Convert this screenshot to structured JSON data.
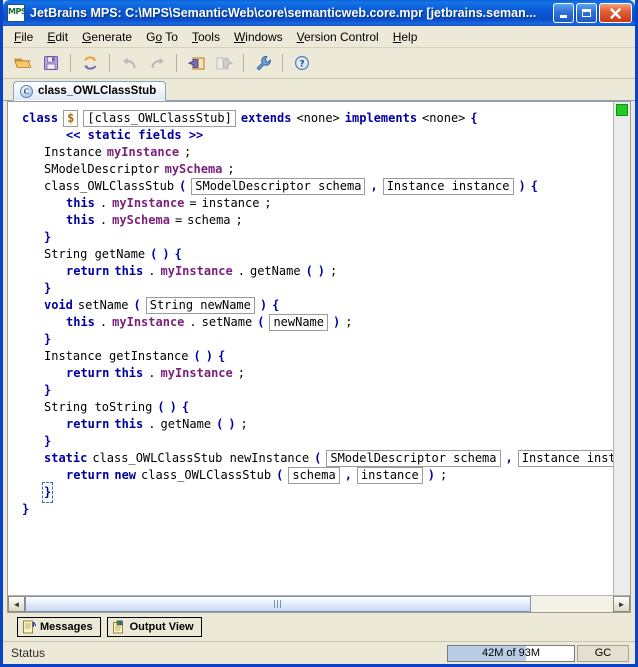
{
  "window": {
    "title": "JetBrains MPS: C:\\MPS\\SemanticWeb\\core\\semanticweb.core.mpr  [jetbrains.seman...",
    "app_icon_label": "MPS",
    "minimize_label": "Minimize",
    "maximize_label": "Maximize",
    "close_label": "Close"
  },
  "menubar": {
    "items": [
      {
        "label": "File",
        "pre": "",
        "mnemonic": "F",
        "post": "ile"
      },
      {
        "label": "Edit",
        "pre": "",
        "mnemonic": "E",
        "post": "dit"
      },
      {
        "label": "Generate",
        "pre": "",
        "mnemonic": "G",
        "post": "enerate"
      },
      {
        "label": "Go To",
        "pre": "G",
        "mnemonic": "o",
        "post": " To"
      },
      {
        "label": "Tools",
        "pre": "",
        "mnemonic": "T",
        "post": "ools"
      },
      {
        "label": "Windows",
        "pre": "",
        "mnemonic": "W",
        "post": "indows"
      },
      {
        "label": "Version Control",
        "pre": "",
        "mnemonic": "V",
        "post": "ersion Control"
      },
      {
        "label": "Help",
        "pre": "",
        "mnemonic": "H",
        "post": "elp"
      }
    ]
  },
  "toolbar": {
    "buttons": [
      {
        "name": "open-project-icon",
        "title": "Open Project",
        "enabled": true
      },
      {
        "name": "save-all-icon",
        "title": "Save All",
        "enabled": true
      },
      {
        "name": "refresh-icon",
        "title": "Refresh",
        "enabled": true
      },
      {
        "name": "undo-icon",
        "title": "Undo",
        "enabled": false
      },
      {
        "name": "redo-icon",
        "title": "Redo",
        "enabled": false
      },
      {
        "name": "back-icon",
        "title": "Back",
        "enabled": true
      },
      {
        "name": "forward-icon",
        "title": "Forward",
        "enabled": false
      },
      {
        "name": "settings-icon",
        "title": "Settings",
        "enabled": true
      },
      {
        "name": "help-icon",
        "title": "Help",
        "enabled": true
      }
    ]
  },
  "tabs": [
    {
      "label": "class_OWLClassStub",
      "icon": "C",
      "active": true
    }
  ],
  "editor": {
    "marker_color": "#22cc22",
    "lines": [
      {
        "id": "l1",
        "indent": 0,
        "tokens": [
          {
            "t": "class",
            "s": "kw",
            "cell": false
          },
          {
            "t": "$",
            "s": "dollar",
            "cell": true
          },
          {
            "t": "[class_OWLClassStub]",
            "s": "plain",
            "cell": true
          },
          {
            "t": "extends",
            "s": "kw",
            "cell": false
          },
          {
            "t": "<none>",
            "s": "plain",
            "cell": false
          },
          {
            "t": "implements",
            "s": "kw",
            "cell": false
          },
          {
            "t": "<none>",
            "s": "plain",
            "cell": false
          },
          {
            "t": "{",
            "s": "kw",
            "cell": false
          }
        ]
      },
      {
        "id": "l2",
        "indent": 2,
        "tokens": [
          {
            "t": "<< static fields >>",
            "s": "kw",
            "cell": false
          }
        ]
      },
      {
        "id": "l3",
        "indent": 1,
        "tokens": [
          {
            "t": "Instance",
            "s": "plain",
            "cell": false
          },
          {
            "t": "myInstance",
            "s": "fld",
            "cell": false
          },
          {
            "t": ";",
            "s": "plain",
            "cell": false
          }
        ]
      },
      {
        "id": "l4",
        "indent": 1,
        "tokens": [
          {
            "t": "SModelDescriptor",
            "s": "plain",
            "cell": false
          },
          {
            "t": "mySchema",
            "s": "fld",
            "cell": false
          },
          {
            "t": ";",
            "s": "plain",
            "cell": false
          }
        ]
      },
      {
        "id": "l5",
        "indent": 1,
        "tokens": [
          {
            "t": "class_OWLClassStub",
            "s": "plain",
            "cell": false
          },
          {
            "t": "(",
            "s": "kw",
            "cell": false
          },
          {
            "t": "SModelDescriptor schema",
            "s": "plain",
            "cell": true
          },
          {
            "t": ",",
            "s": "kw",
            "cell": false
          },
          {
            "t": "Instance instance",
            "s": "plain",
            "cell": true
          },
          {
            "t": ")",
            "s": "kw",
            "cell": false
          },
          {
            "t": "{",
            "s": "kw",
            "cell": false
          }
        ]
      },
      {
        "id": "l6",
        "indent": 2,
        "tokens": [
          {
            "t": "this",
            "s": "kw",
            "cell": false
          },
          {
            "t": ".",
            "s": "plain",
            "cell": false
          },
          {
            "t": "myInstance",
            "s": "fld",
            "cell": false
          },
          {
            "t": "=",
            "s": "plain",
            "cell": false
          },
          {
            "t": "instance",
            "s": "plain",
            "cell": false
          },
          {
            "t": ";",
            "s": "plain",
            "cell": false
          }
        ]
      },
      {
        "id": "l7",
        "indent": 2,
        "tokens": [
          {
            "t": "this",
            "s": "kw",
            "cell": false
          },
          {
            "t": ".",
            "s": "plain",
            "cell": false
          },
          {
            "t": "mySchema",
            "s": "fld",
            "cell": false
          },
          {
            "t": "=",
            "s": "plain",
            "cell": false
          },
          {
            "t": "schema",
            "s": "plain",
            "cell": false
          },
          {
            "t": ";",
            "s": "plain",
            "cell": false
          }
        ]
      },
      {
        "id": "l8",
        "indent": 1,
        "tokens": [
          {
            "t": "}",
            "s": "kw",
            "cell": false
          }
        ]
      },
      {
        "id": "l9",
        "indent": 1,
        "tokens": [
          {
            "t": "String getName",
            "s": "plain",
            "cell": false
          },
          {
            "t": "(",
            "s": "kw",
            "cell": false
          },
          {
            "t": ")",
            "s": "kw",
            "cell": false
          },
          {
            "t": "{",
            "s": "kw",
            "cell": false
          }
        ]
      },
      {
        "id": "l10",
        "indent": 2,
        "tokens": [
          {
            "t": "return",
            "s": "kw",
            "cell": false
          },
          {
            "t": "this",
            "s": "kw",
            "cell": false
          },
          {
            "t": ".",
            "s": "plain",
            "cell": false
          },
          {
            "t": "myInstance",
            "s": "fld",
            "cell": false
          },
          {
            "t": ".",
            "s": "plain",
            "cell": false
          },
          {
            "t": "getName",
            "s": "plain",
            "cell": false
          },
          {
            "t": "(",
            "s": "kw",
            "cell": false
          },
          {
            "t": ")",
            "s": "kw",
            "cell": false
          },
          {
            "t": ";",
            "s": "plain",
            "cell": false
          }
        ]
      },
      {
        "id": "l11",
        "indent": 1,
        "tokens": [
          {
            "t": "}",
            "s": "kw",
            "cell": false
          }
        ]
      },
      {
        "id": "l12",
        "indent": 1,
        "tokens": [
          {
            "t": "void",
            "s": "kw",
            "cell": false
          },
          {
            "t": "setName",
            "s": "plain",
            "cell": false
          },
          {
            "t": "(",
            "s": "kw",
            "cell": false
          },
          {
            "t": "String newName",
            "s": "plain",
            "cell": true
          },
          {
            "t": ")",
            "s": "kw",
            "cell": false
          },
          {
            "t": "{",
            "s": "kw",
            "cell": false
          }
        ]
      },
      {
        "id": "l13",
        "indent": 2,
        "tokens": [
          {
            "t": "this",
            "s": "kw",
            "cell": false
          },
          {
            "t": ".",
            "s": "plain",
            "cell": false
          },
          {
            "t": "myInstance",
            "s": "fld",
            "cell": false
          },
          {
            "t": ".",
            "s": "plain",
            "cell": false
          },
          {
            "t": "setName",
            "s": "plain",
            "cell": false
          },
          {
            "t": "(",
            "s": "kw",
            "cell": false
          },
          {
            "t": "newName",
            "s": "plain",
            "cell": true
          },
          {
            "t": ")",
            "s": "kw",
            "cell": false
          },
          {
            "t": ";",
            "s": "plain",
            "cell": false
          }
        ]
      },
      {
        "id": "l14",
        "indent": 1,
        "tokens": [
          {
            "t": "}",
            "s": "kw",
            "cell": false
          }
        ]
      },
      {
        "id": "l15",
        "indent": 1,
        "tokens": [
          {
            "t": "Instance getInstance",
            "s": "plain",
            "cell": false
          },
          {
            "t": "(",
            "s": "kw",
            "cell": false
          },
          {
            "t": ")",
            "s": "kw",
            "cell": false
          },
          {
            "t": "{",
            "s": "kw",
            "cell": false
          }
        ]
      },
      {
        "id": "l16",
        "indent": 2,
        "tokens": [
          {
            "t": "return",
            "s": "kw",
            "cell": false
          },
          {
            "t": "this",
            "s": "kw",
            "cell": false
          },
          {
            "t": ".",
            "s": "plain",
            "cell": false
          },
          {
            "t": "myInstance",
            "s": "fld",
            "cell": false
          },
          {
            "t": ";",
            "s": "plain",
            "cell": false
          }
        ]
      },
      {
        "id": "l17",
        "indent": 1,
        "tokens": [
          {
            "t": "}",
            "s": "kw",
            "cell": false
          }
        ]
      },
      {
        "id": "l18",
        "indent": 1,
        "tokens": [
          {
            "t": "String toString",
            "s": "plain",
            "cell": false
          },
          {
            "t": "(",
            "s": "kw",
            "cell": false
          },
          {
            "t": ")",
            "s": "kw",
            "cell": false
          },
          {
            "t": "{",
            "s": "kw",
            "cell": false
          }
        ]
      },
      {
        "id": "l19",
        "indent": 2,
        "tokens": [
          {
            "t": "return",
            "s": "kw",
            "cell": false
          },
          {
            "t": "this",
            "s": "kw",
            "cell": false
          },
          {
            "t": ".",
            "s": "plain",
            "cell": false
          },
          {
            "t": "getName",
            "s": "plain",
            "cell": false
          },
          {
            "t": "(",
            "s": "kw",
            "cell": false
          },
          {
            "t": ")",
            "s": "kw",
            "cell": false
          },
          {
            "t": ";",
            "s": "plain",
            "cell": false
          }
        ]
      },
      {
        "id": "l20",
        "indent": 1,
        "tokens": [
          {
            "t": "}",
            "s": "kw",
            "cell": false
          }
        ]
      },
      {
        "id": "l21",
        "indent": 1,
        "tokens": [
          {
            "t": "static",
            "s": "kw",
            "cell": false
          },
          {
            "t": "class_OWLClassStub newInstance",
            "s": "plain",
            "cell": false
          },
          {
            "t": "(",
            "s": "kw",
            "cell": false
          },
          {
            "t": "SModelDescriptor schema",
            "s": "plain",
            "cell": true
          },
          {
            "t": ",",
            "s": "kw",
            "cell": false
          },
          {
            "t": "Instance insta",
            "s": "plain",
            "cell": true
          }
        ]
      },
      {
        "id": "l22",
        "indent": 2,
        "tokens": [
          {
            "t": "return",
            "s": "kw",
            "cell": false
          },
          {
            "t": "new",
            "s": "kw",
            "cell": false
          },
          {
            "t": "class_OWLClassStub",
            "s": "plain",
            "cell": false
          },
          {
            "t": "(",
            "s": "kw",
            "cell": false
          },
          {
            "t": "schema",
            "s": "plain",
            "cell": true
          },
          {
            "t": ",",
            "s": "kw",
            "cell": false
          },
          {
            "t": "instance",
            "s": "plain",
            "cell": true
          },
          {
            "t": ")",
            "s": "kw",
            "cell": false
          },
          {
            "t": ";",
            "s": "plain",
            "cell": false
          }
        ]
      },
      {
        "id": "l23",
        "indent": 1,
        "selected": true,
        "tokens": [
          {
            "t": "}",
            "s": "kw",
            "cell": false
          }
        ]
      },
      {
        "id": "l24",
        "indent": 0,
        "tokens": [
          {
            "t": "}",
            "s": "kw",
            "cell": false
          }
        ]
      }
    ]
  },
  "hscroll": {
    "left_arrow": "◄",
    "right_arrow": "►",
    "thumb_percent": 86
  },
  "bottom_buttons": [
    {
      "label": "Messages",
      "icon": "messages-icon"
    },
    {
      "label": "Output View",
      "icon": "output-view-icon"
    }
  ],
  "statusbar": {
    "status": "Status",
    "memory": "42M of 93M",
    "gc": "GC"
  }
}
